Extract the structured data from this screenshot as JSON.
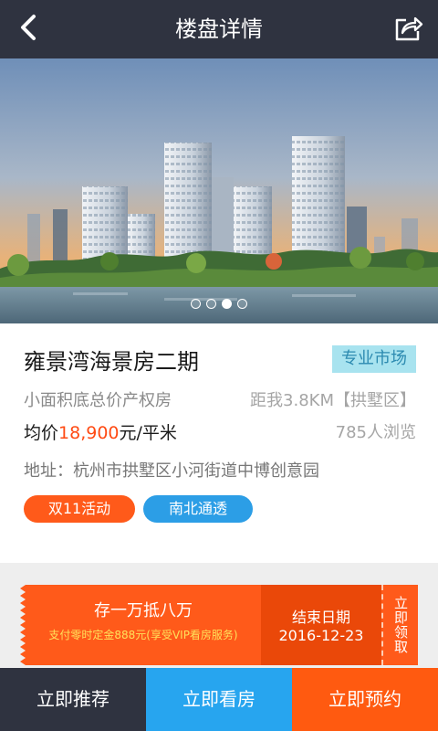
{
  "header": {
    "title": "楼盘详情",
    "back_icon": "chevron-left-icon",
    "share_icon": "share-icon"
  },
  "banner": {
    "slide_count": 4,
    "active_index": 2
  },
  "property": {
    "name": "雍景湾海景房二期",
    "market_tag": "专业市场",
    "subtitle": "小面积底总价产权房",
    "distance": "距我3.8KM【拱墅区】",
    "price_prefix": "均价",
    "price_value": "18,900",
    "price_unit": "元/平米",
    "views": "785人浏览",
    "address": "地址：杭州市拱墅区小河街道中博创意园",
    "chips": [
      "双11活动",
      "南北通透"
    ]
  },
  "coupon": {
    "title": "存一万抵八万",
    "description": "支付零时定金888元(享受VIP看房服务)",
    "end_label": "结束日期",
    "end_date": "2016-12-23",
    "claim_label": "立即领取"
  },
  "bottom_bar": {
    "recommend": "立即推荐",
    "visit": "立即看房",
    "book": "立即预约"
  },
  "colors": {
    "header_bg": "#2f3340",
    "accent_orange": "#ff5a10",
    "accent_blue": "#27a5ef",
    "price_red": "#ff4a13"
  }
}
